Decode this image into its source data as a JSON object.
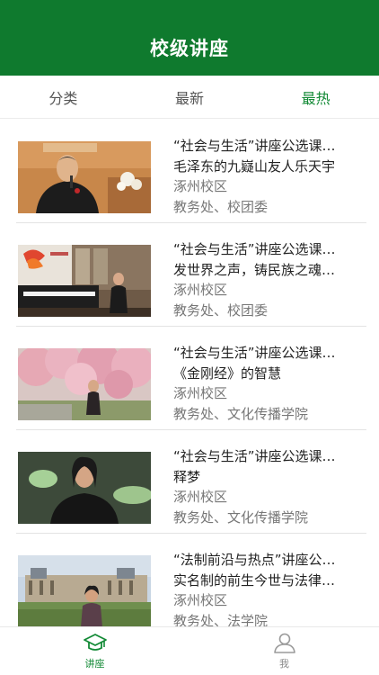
{
  "header": {
    "title": "校级讲座"
  },
  "tabs": [
    {
      "label": "分类",
      "active": false
    },
    {
      "label": "最新",
      "active": false
    },
    {
      "label": "最热",
      "active": true
    }
  ],
  "lectures": [
    {
      "series": "“社会与生活”讲座公选课…",
      "title": "毛泽东的九嶷山友人乐天宇",
      "campus": "涿州校区",
      "organizer": "教务处、校团委",
      "thumb": "speaker-podium-photo"
    },
    {
      "series": "“社会与生活”讲座公选课…",
      "title": "发世界之声，铸民族之魂…",
      "campus": "涿州校区",
      "organizer": "教务处、校团委",
      "thumb": "piano-stage-photo"
    },
    {
      "series": "“社会与生活”讲座公选课…",
      "title": "《金刚经》的智慧",
      "campus": "涿州校区",
      "organizer": "教务处、文化传播学院",
      "thumb": "cherry-blossom-photo"
    },
    {
      "series": "“社会与生活”讲座公选课…",
      "title": "释梦",
      "campus": "涿州校区",
      "organizer": "教务处、文化传播学院",
      "thumb": "speaker-dark-background-photo"
    },
    {
      "series": "“法制前沿与热点”讲座公…",
      "title": "实名制的前生今世与法律…",
      "campus": "涿州校区",
      "organizer": "教务处、法学院",
      "thumb": "louvre-palace-photo"
    }
  ],
  "tabbar": [
    {
      "label": "讲座",
      "icon": "graduation-cap-icon",
      "active": true
    },
    {
      "label": "我",
      "icon": "person-icon",
      "active": false
    }
  ],
  "colors": {
    "header": "#0f7a2e",
    "accent": "#138a36"
  }
}
